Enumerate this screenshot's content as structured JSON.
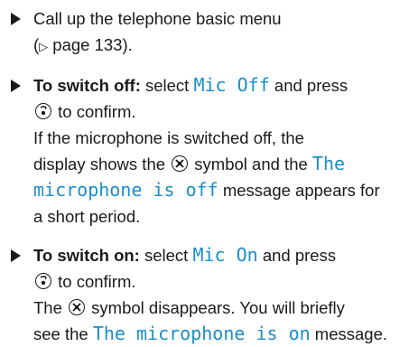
{
  "steps": [
    {
      "lines": [
        {
          "t1": "Call up the telephone basic menu"
        },
        {
          "t1": "(",
          "tri": "▷",
          "t2": " page 133)."
        }
      ]
    },
    {
      "lead": "To switch off:",
      "line1_a": " select ",
      "line1_disp": "Mic Off",
      "line1_b": " and press",
      "line2": " to confirm.",
      "line3": "If the microphone is switched off, the",
      "line4_a": "display shows the ",
      "line4_b": " symbol and the ",
      "line4_disp": "The",
      "line5_disp": "microphone is off",
      "line5_b": " message appears for",
      "line6": "a short period."
    },
    {
      "lead": "To switch on:",
      "line1_a": " select ",
      "line1_disp": "Mic On",
      "line1_b": " and press",
      "line2": " to confirm.",
      "line3_a": "The ",
      "line3_b": " symbol disappears. You will briefly",
      "line4_a": "see the ",
      "line4_disp": "The microphone is on",
      "line4_b": " message."
    }
  ],
  "colors": {
    "display_text": "#1a8ecb",
    "body_text": "#1a1a1a"
  }
}
